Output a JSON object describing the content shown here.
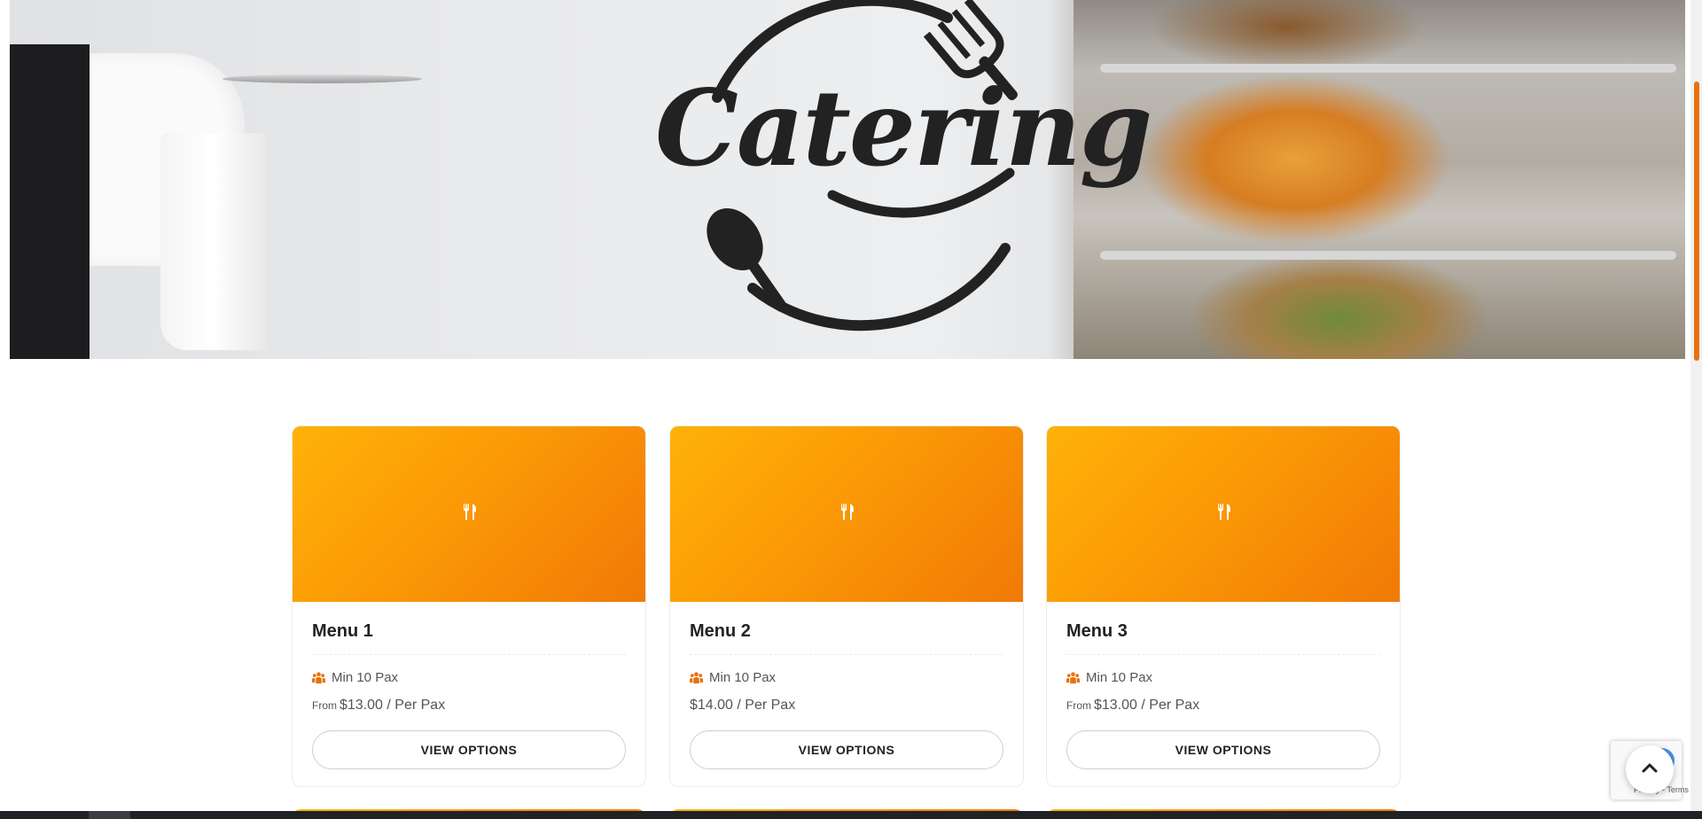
{
  "hero": {
    "logo_text": "Catering"
  },
  "colors": {
    "accent": "#f17906",
    "card_gradient_start": "#ffb208",
    "card_gradient_end": "#f17906"
  },
  "icons": {
    "card_banner": "fork-knife-icon",
    "pax": "group-icon",
    "scroll_top": "chevron-up-icon"
  },
  "menus": [
    {
      "title": "Menu 1",
      "pax": "Min 10 Pax",
      "price_prefix": "From",
      "price": "$13.00 / Per Pax",
      "button": "VIEW OPTIONS"
    },
    {
      "title": "Menu 2",
      "pax": "Min 10 Pax",
      "price_prefix": "",
      "price": "$14.00 / Per Pax",
      "button": "VIEW OPTIONS"
    },
    {
      "title": "Menu 3",
      "pax": "Min 10 Pax",
      "price_prefix": "From",
      "price": "$13.00 / Per Pax",
      "button": "VIEW OPTIONS"
    }
  ],
  "recaptcha": {
    "links": "Privacy - Terms"
  }
}
